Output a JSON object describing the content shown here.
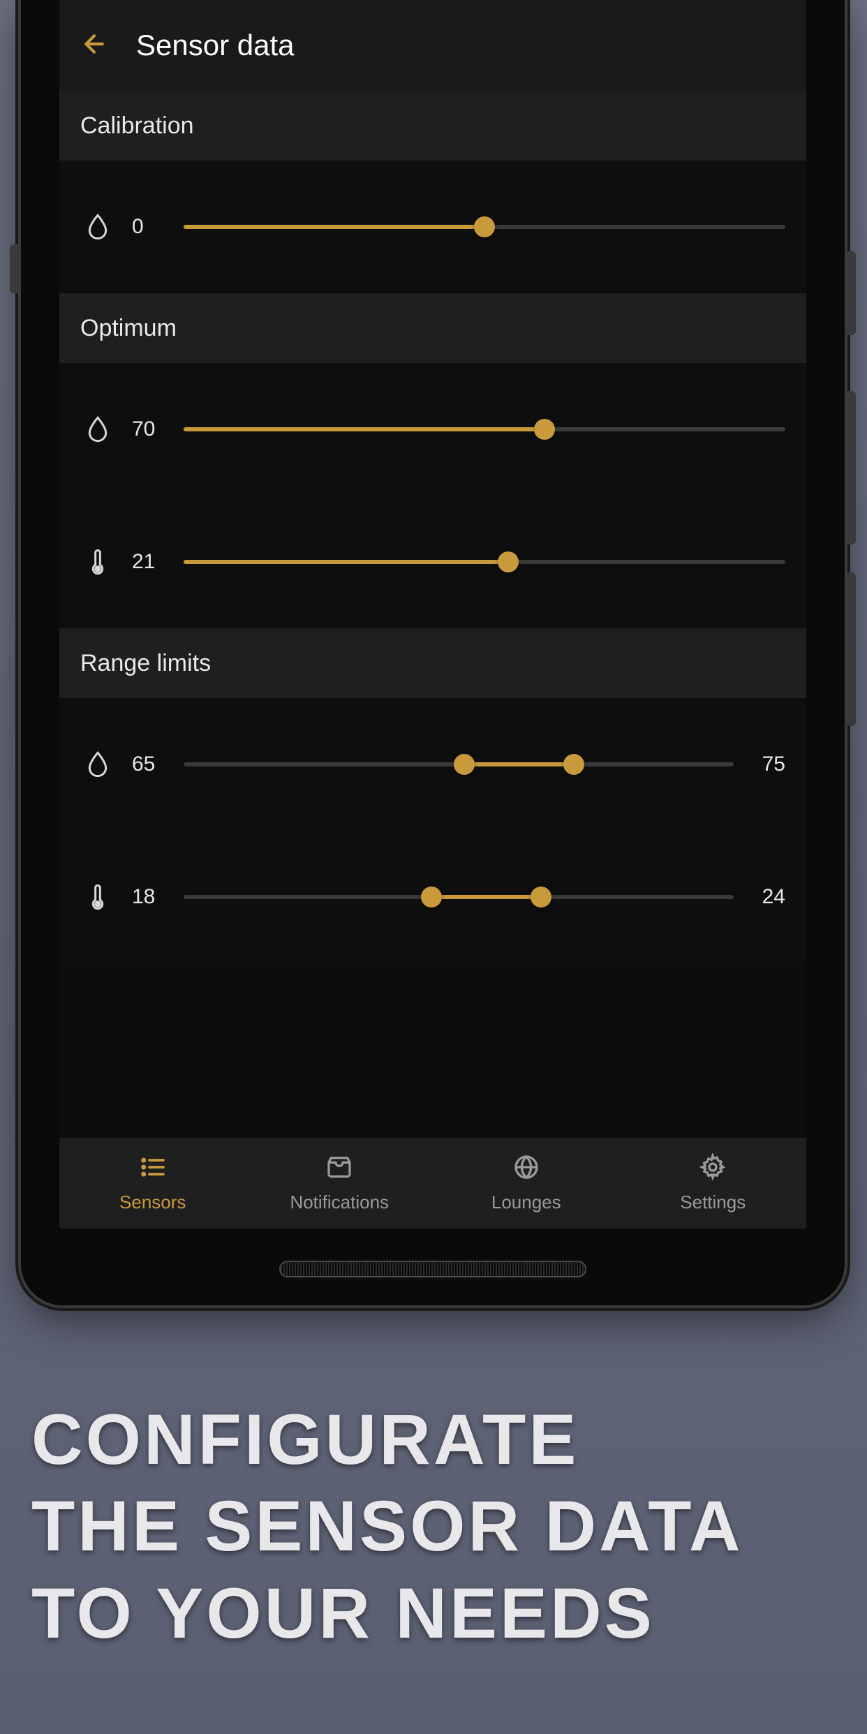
{
  "header": {
    "title": "Sensor data"
  },
  "sections": {
    "calibration": {
      "label": "Calibration",
      "humidity": {
        "value": "0",
        "fillPct": 50
      }
    },
    "optimum": {
      "label": "Optimum",
      "humidity": {
        "value": "70",
        "fillPct": 60
      },
      "temperature": {
        "value": "21",
        "fillPct": 54
      }
    },
    "range": {
      "label": "Range limits",
      "humidity": {
        "low": "65",
        "high": "75",
        "lowPct": 51,
        "highPct": 71
      },
      "temperature": {
        "low": "18",
        "high": "24",
        "lowPct": 45,
        "highPct": 65
      }
    }
  },
  "nav": {
    "sensors": "Sensors",
    "notifications": "Notifications",
    "lounges": "Lounges",
    "settings": "Settings"
  },
  "marketing": {
    "line1": "CONFIGURATE",
    "line2": "THE SENSOR DATA",
    "line3": "TO YOUR NEEDS"
  },
  "colors": {
    "accent": "#c99a3b"
  }
}
